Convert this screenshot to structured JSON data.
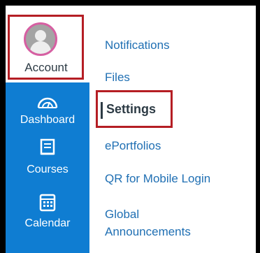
{
  "sidebar": {
    "account_label": "Account",
    "items": [
      {
        "label": "Dashboard",
        "icon": "dashboard-icon"
      },
      {
        "label": "Courses",
        "icon": "courses-icon"
      },
      {
        "label": "Calendar",
        "icon": "calendar-icon"
      }
    ]
  },
  "menu": {
    "items": [
      {
        "label": "Notifications"
      },
      {
        "label": "Files"
      },
      {
        "label": "Settings"
      },
      {
        "label": "ePortfolios"
      },
      {
        "label": "QR for Mobile Login"
      },
      {
        "label": "Global\nAnnouncements"
      }
    ],
    "active": "Settings"
  },
  "colors": {
    "sidebar_blue": "#0f7dd2",
    "highlight_red": "#b51e24",
    "link_blue": "#1f6fb3",
    "text_dark": "#2d3b45"
  }
}
